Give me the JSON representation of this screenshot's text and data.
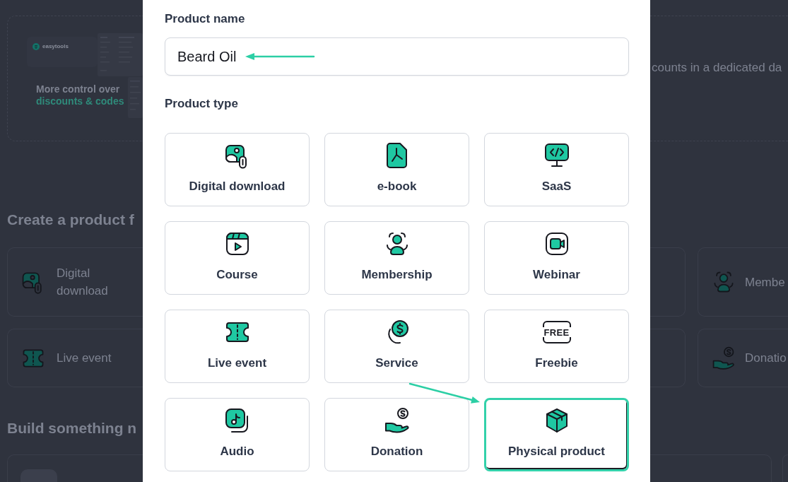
{
  "background": {
    "promo_banner": {
      "logo_text": "easytools",
      "title": "More control over",
      "highlight": "discounts & codes",
      "text": "counts in a dedicated da"
    },
    "create_section": {
      "heading": "Create a product f",
      "cards_left": [
        {
          "label": "Digital download"
        },
        {
          "label": "Live event"
        }
      ],
      "cards_right": [
        {
          "label": "Membe"
        },
        {
          "label": "Donatio"
        }
      ]
    },
    "build_section": {
      "heading": "Build something n"
    }
  },
  "dialog": {
    "name_field": {
      "label": "Product name",
      "value": "Beard Oil"
    },
    "type_field": {
      "label": "Product type",
      "freebie_icon_text": "FREE",
      "options": [
        {
          "label": "Digital download",
          "selected": false
        },
        {
          "label": "e-book",
          "selected": false
        },
        {
          "label": "SaaS",
          "selected": false
        },
        {
          "label": "Course",
          "selected": false
        },
        {
          "label": "Membership",
          "selected": false
        },
        {
          "label": "Webinar",
          "selected": false
        },
        {
          "label": "Live event",
          "selected": false
        },
        {
          "label": "Service",
          "selected": false
        },
        {
          "label": "Freebie",
          "selected": false
        },
        {
          "label": "Audio",
          "selected": false
        },
        {
          "label": "Donation",
          "selected": false
        },
        {
          "label": "Physical product",
          "selected": true
        }
      ]
    }
  }
}
